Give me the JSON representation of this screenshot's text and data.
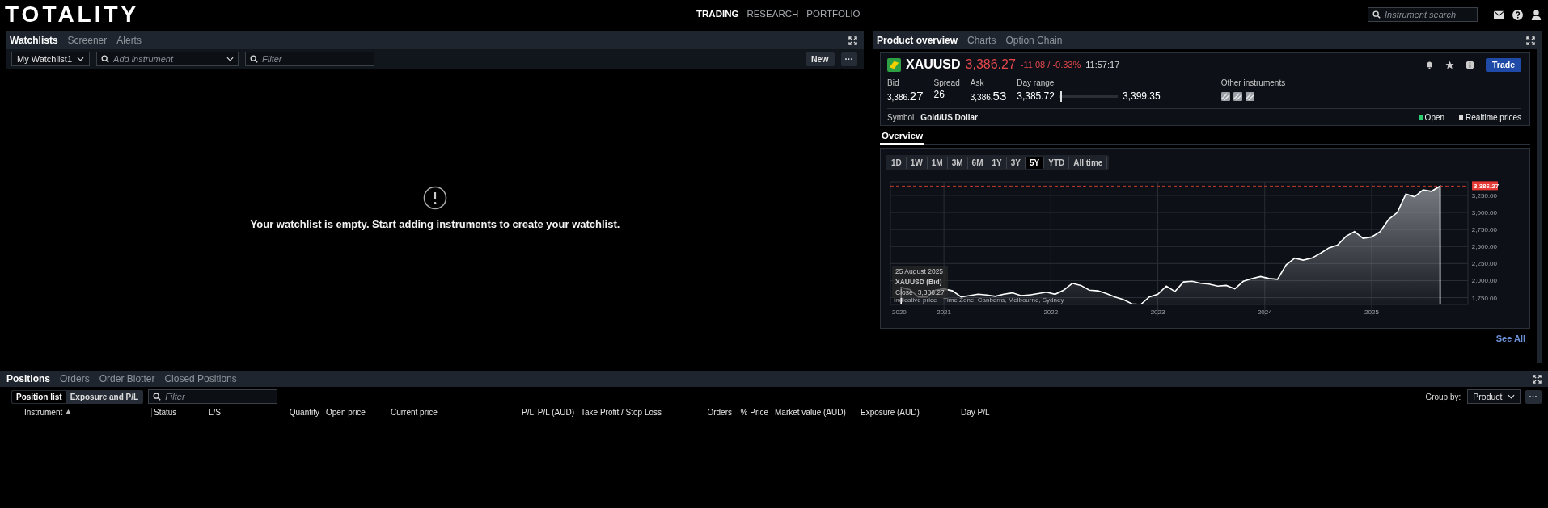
{
  "header": {
    "logo": "TOTALITY",
    "nav": [
      {
        "label": "TRADING",
        "selected": true
      },
      {
        "label": "RESEARCH",
        "selected": false
      },
      {
        "label": "PORTFOLIO",
        "selected": false
      }
    ],
    "search": {
      "placeholder": "Instrument search"
    }
  },
  "watchlists": {
    "tabs": [
      {
        "label": "Watchlists",
        "selected": true
      },
      {
        "label": "Screener",
        "selected": false
      },
      {
        "label": "Alerts",
        "selected": false
      }
    ],
    "list_select": "My Watchlist1",
    "add_field": {
      "placeholder": "Add instrument"
    },
    "filter": {
      "placeholder": "Filter"
    },
    "new_button": "New",
    "more_button": "···",
    "empty_message": "Your watchlist is empty. Start adding instruments to create your watchlist."
  },
  "product": {
    "tabs": [
      {
        "label": "Product overview",
        "selected": true
      },
      {
        "label": "Charts",
        "selected": false
      },
      {
        "label": "Option Chain",
        "selected": false
      }
    ],
    "symbol": "XAUUSD",
    "price": "3,386.27",
    "change": "-11.08 / -0.33%",
    "time": "11:57:17",
    "trade_button": "Trade",
    "bid": {
      "label": "Bid",
      "small": "3,386.",
      "big": "27"
    },
    "spread": {
      "label": "Spread",
      "value": "26"
    },
    "ask": {
      "label": "Ask",
      "small": "3,386.",
      "big": "53"
    },
    "day_range": {
      "label": "Day range",
      "low": "3,385.72",
      "high": "3,399.35",
      "level": 0.02
    },
    "other_instruments": "Other instruments",
    "symbol_label": "Symbol",
    "symbol_name": "Gold/US Dollar",
    "status": [
      {
        "label": "Open",
        "color": "#2ecc71"
      },
      {
        "label": "Realtime prices",
        "color": "#d8d8d8"
      }
    ],
    "section_tab": "Overview",
    "ranges": [
      {
        "label": "1D",
        "selected": false
      },
      {
        "label": "1W",
        "selected": false
      },
      {
        "label": "1M",
        "selected": false
      },
      {
        "label": "3M",
        "selected": false
      },
      {
        "label": "6M",
        "selected": false
      },
      {
        "label": "1Y",
        "selected": false
      },
      {
        "label": "3Y",
        "selected": false
      },
      {
        "label": "5Y",
        "selected": true
      },
      {
        "label": "YTD",
        "selected": false
      },
      {
        "label": "All time",
        "selected": false
      }
    ],
    "chart_data": {
      "type": "area",
      "grid": true,
      "xlim": [
        2020.5,
        2025.9
      ],
      "ylim": [
        1650,
        3450
      ],
      "x": [
        2020.6,
        2020.68,
        2020.76,
        2020.84,
        2020.92,
        2021.0,
        2021.08,
        2021.16,
        2021.24,
        2021.32,
        2021.4,
        2021.48,
        2021.56,
        2021.64,
        2021.72,
        2021.8,
        2021.88,
        2021.96,
        2022.04,
        2022.12,
        2022.2,
        2022.28,
        2022.36,
        2022.44,
        2022.52,
        2022.6,
        2022.68,
        2022.76,
        2022.84,
        2022.92,
        2023.0,
        2023.08,
        2023.16,
        2023.24,
        2023.32,
        2023.4,
        2023.48,
        2023.56,
        2023.64,
        2023.72,
        2023.8,
        2023.88,
        2023.96,
        2024.04,
        2024.12,
        2024.2,
        2024.28,
        2024.36,
        2024.44,
        2024.52,
        2024.6,
        2024.68,
        2024.76,
        2024.84,
        2024.92,
        2025.0,
        2025.08,
        2025.16,
        2025.24,
        2025.32,
        2025.4,
        2025.48,
        2025.56,
        2025.64
      ],
      "series": [
        {
          "name": "XAUUSD (Bid)",
          "color": "#ffffff",
          "values": [
            1900,
            1870,
            1760,
            1760,
            1860,
            1880,
            1850,
            1760,
            1780,
            1800,
            1790,
            1770,
            1800,
            1820,
            1780,
            1790,
            1810,
            1830,
            1800,
            1860,
            1960,
            1930,
            1860,
            1850,
            1810,
            1760,
            1720,
            1660,
            1650,
            1760,
            1800,
            1920,
            1840,
            1980,
            1990,
            1960,
            1950,
            1920,
            1930,
            1880,
            1990,
            2030,
            2060,
            2030,
            2020,
            2230,
            2330,
            2300,
            2330,
            2400,
            2480,
            2520,
            2650,
            2720,
            2620,
            2640,
            2720,
            2900,
            3000,
            3270,
            3230,
            3330,
            3310,
            3386
          ]
        }
      ],
      "xticks": [
        {
          "value": 2021,
          "label": "2021"
        },
        {
          "value": 2022,
          "label": "2022"
        },
        {
          "value": 2023,
          "label": "2023"
        },
        {
          "value": 2024,
          "label": "2024"
        },
        {
          "value": 2025,
          "label": "2025"
        }
      ],
      "yticks": [
        {
          "value": 1750,
          "label": "1,750.00"
        },
        {
          "value": 2000,
          "label": "2,000.00"
        },
        {
          "value": 2250,
          "label": "2,250.00"
        },
        {
          "value": 2500,
          "label": "2,500.00"
        },
        {
          "value": 2750,
          "label": "2,750.00"
        },
        {
          "value": 3000,
          "label": "3,000.00"
        },
        {
          "value": 3250,
          "label": "3,250.00"
        }
      ],
      "ref_lines": [
        {
          "axis": "y",
          "value": 3386.27,
          "label": "3,386.27"
        }
      ]
    },
    "x_start_label": "2020",
    "tooltip": {
      "date": "25 August 2025",
      "label": "Close",
      "value": "3,386.27"
    },
    "footnote": "Indicative price",
    "timezone": "Time Zone: Canberra, Melbourne, Sydney",
    "see_all": "See All"
  },
  "positions": {
    "tabs": [
      {
        "label": "Positions",
        "selected": true
      },
      {
        "label": "Orders",
        "selected": false
      },
      {
        "label": "Order Blotter",
        "selected": false
      },
      {
        "label": "Closed Positions",
        "selected": false
      }
    ],
    "views": [
      {
        "label": "Position list",
        "selected": true
      },
      {
        "label": "Exposure and P/L",
        "selected": false
      }
    ],
    "filter": {
      "placeholder": "Filter"
    },
    "group_by_label": "Group by:",
    "group_by": "Product",
    "more_button": "···",
    "columns": [
      "Instrument",
      "Status",
      "L/S",
      "Quantity",
      "Open price",
      "Current price",
      "P/L",
      "P/L (AUD)",
      "Take Profit / Stop Loss",
      "Orders",
      "% Price",
      "Market value (AUD)",
      "Exposure (AUD)",
      "Day P/L"
    ]
  }
}
